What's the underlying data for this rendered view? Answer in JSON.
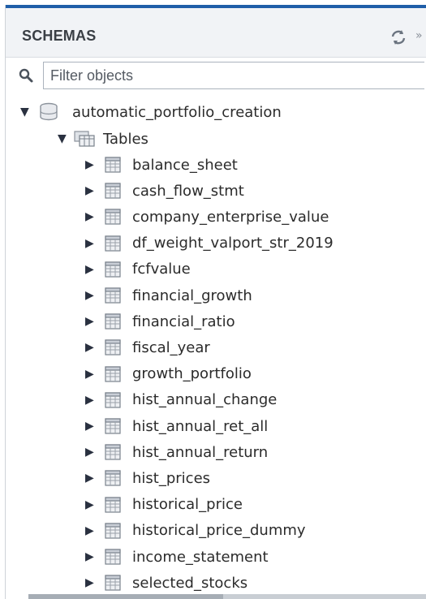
{
  "panel": {
    "title": "SCHEMAS",
    "extra_symbol": "»"
  },
  "filter": {
    "placeholder": "Filter objects",
    "value": ""
  },
  "tree": {
    "schema": {
      "name": "automatic_portfolio_creation",
      "expanded": true
    },
    "tables_folder": {
      "label": "Tables",
      "expanded": true
    },
    "tables": [
      "balance_sheet",
      "cash_flow_stmt",
      "company_enterprise_value",
      "df_weight_valport_str_2019",
      "fcfvalue",
      "financial_growth",
      "financial_ratio",
      "fiscal_year",
      "growth_portfolio",
      "hist_annual_change",
      "hist_annual_ret_all",
      "hist_annual_return",
      "hist_prices",
      "historical_price",
      "historical_price_dummy",
      "income_statement",
      "selected_stocks"
    ]
  },
  "colors": {
    "accent": "#1f5ea8",
    "header_bg": "#f1f3f6",
    "text": "#2b2b2b"
  }
}
